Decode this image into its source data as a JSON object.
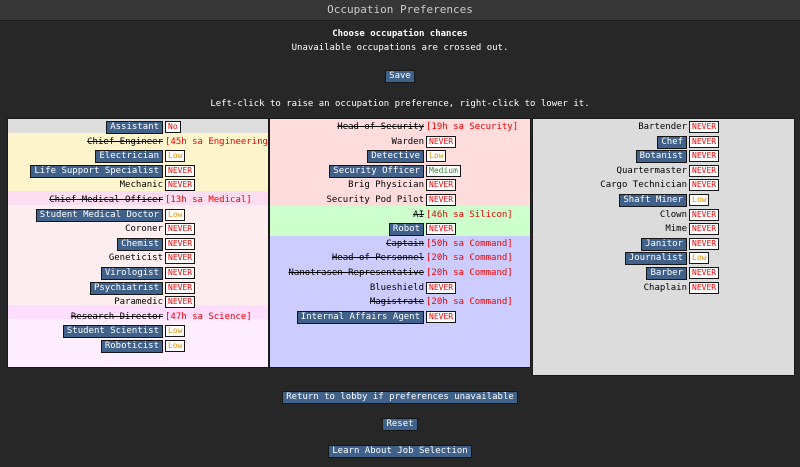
{
  "window": {
    "title": "Occupation Preferences"
  },
  "header": {
    "heading": "Choose occupation chances",
    "subheading": "Unavailable occupations are crossed out.",
    "save_label": "Save",
    "instructions": "Left-click to raise an occupation preference, right-click to lower it."
  },
  "colors": {
    "button": "#40628a",
    "never": "#ee0000",
    "low": "#e09000",
    "medium": "#3a8a3a",
    "command": "#ccccff",
    "security": "#ffdddd",
    "engineering": "#fff5cc",
    "medical": "#ffeef0",
    "science": "#ffeeff",
    "silicon": "#ccffcc",
    "civilian": "#dddddd"
  },
  "columns": [
    {
      "rows": [
        {
          "job": "Assistant",
          "button": true,
          "pref": "No",
          "style": "no"
        },
        {
          "job": "Chief Engineer",
          "struck": true,
          "reason": "[45h sa Engineering]"
        },
        {
          "job": "Electrician",
          "button": true,
          "pref": "Low",
          "style": "low"
        },
        {
          "job": "Life Support Specialist",
          "button": true,
          "pref": "NEVER",
          "style": "never"
        },
        {
          "job": "Mechanic",
          "pref": "NEVER",
          "style": "never"
        },
        {
          "job": "Chief Medical Officer",
          "struck": true,
          "reason": "[13h sa Medical]"
        },
        {
          "job": "Student Medical Doctor",
          "button": true,
          "pref": "Low",
          "style": "low"
        },
        {
          "job": "Coroner",
          "pref": "NEVER",
          "style": "never"
        },
        {
          "job": "Chemist",
          "button": true,
          "pref": "NEVER",
          "style": "never"
        },
        {
          "job": "Geneticist",
          "pref": "NEVER",
          "style": "never"
        },
        {
          "job": "Virologist",
          "button": true,
          "pref": "NEVER",
          "style": "never"
        },
        {
          "job": "Psychiatrist",
          "button": true,
          "pref": "NEVER",
          "style": "never"
        },
        {
          "job": "Paramedic",
          "pref": "NEVER",
          "style": "never"
        },
        {
          "job": "Research Director",
          "struck": true,
          "reason": "[47h sa Science]"
        },
        {
          "job": "Student Scientist",
          "button": true,
          "pref": "Low",
          "style": "low"
        },
        {
          "job": "Roboticist",
          "button": true,
          "pref": "Low",
          "style": "low"
        }
      ]
    },
    {
      "rows": [
        {
          "job": "Head of Security",
          "struck": true,
          "reason": "[19h sa Security]"
        },
        {
          "job": "Warden",
          "pref": "NEVER",
          "style": "never"
        },
        {
          "job": "Detective",
          "button": true,
          "pref": "Low",
          "style": "low"
        },
        {
          "job": "Security Officer",
          "button": true,
          "pref": "Medium",
          "style": "medium"
        },
        {
          "job": "Brig Physician",
          "pref": "NEVER",
          "style": "never"
        },
        {
          "job": "Security Pod Pilot",
          "pref": "NEVER",
          "style": "never"
        },
        {
          "job": "AI",
          "struck": true,
          "reason": "[46h sa Silicon]"
        },
        {
          "job": "Robot",
          "button": true,
          "pref": "NEVER",
          "style": "never"
        },
        {
          "job": "Captain",
          "struck": true,
          "reason": "[50h sa Command]"
        },
        {
          "job": "Head of Personnel",
          "struck": true,
          "reason": "[20h sa Command]"
        },
        {
          "job": "Nanotrasen Representative",
          "struck": true,
          "reason": "[20h sa Command]"
        },
        {
          "job": "Blueshield",
          "pref": "NEVER",
          "style": "never"
        },
        {
          "job": "Magistrate",
          "struck": true,
          "reason": "[20h sa Command]"
        },
        {
          "job": "Internal Affairs Agent",
          "button": true,
          "pref": "NEVER",
          "style": "never"
        }
      ]
    },
    {
      "rows": [
        {
          "job": "Bartender",
          "pref": "NEVER",
          "style": "never"
        },
        {
          "job": "Chef",
          "button": true,
          "pref": "NEVER",
          "style": "never"
        },
        {
          "job": "Botanist",
          "button": true,
          "pref": "NEVER",
          "style": "never"
        },
        {
          "job": "Quartermaster",
          "pref": "NEVER",
          "style": "never"
        },
        {
          "job": "Cargo Technician",
          "pref": "NEVER",
          "style": "never"
        },
        {
          "job": "Shaft Miner",
          "button": true,
          "pref": "Low",
          "style": "low"
        },
        {
          "job": "Clown",
          "pref": "NEVER",
          "style": "never"
        },
        {
          "job": "Mime",
          "pref": "NEVER",
          "style": "never"
        },
        {
          "job": "Janitor",
          "button": true,
          "pref": "NEVER",
          "style": "never"
        },
        {
          "job": "Journalist",
          "button": true,
          "pref": "Low",
          "style": "low"
        },
        {
          "job": "Barber",
          "button": true,
          "pref": "NEVER",
          "style": "never"
        },
        {
          "job": "Chaplain",
          "pref": "NEVER",
          "style": "never"
        }
      ]
    }
  ],
  "footer": {
    "return_label": "Return to lobby if preferences unavailable",
    "reset_label": "Reset",
    "learn_label": "Learn About Job Selection"
  }
}
